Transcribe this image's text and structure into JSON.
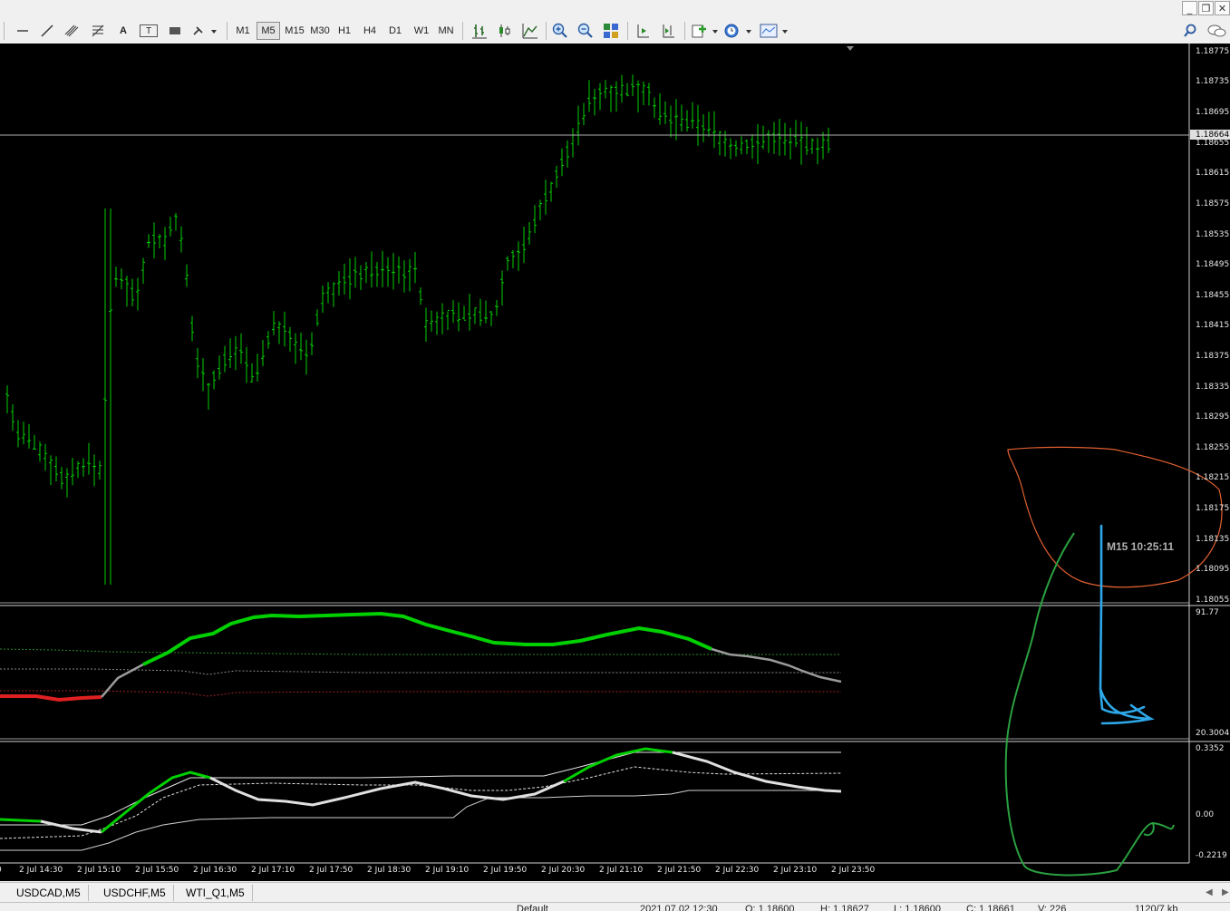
{
  "window_controls": {
    "minimize": "_",
    "restore": "❐",
    "close": "✕"
  },
  "toolbar": {
    "timeframes": [
      "M1",
      "M5",
      "M15",
      "M30",
      "H1",
      "H4",
      "D1",
      "W1",
      "MN"
    ],
    "active_timeframe": "M5",
    "text_tool_label": "A",
    "text_label_tool": "T"
  },
  "price_axis": {
    "labels": [
      "1.18775",
      "1.18735",
      "1.18695",
      "1.18655",
      "1.18615",
      "1.18575",
      "1.18535",
      "1.18495",
      "1.18455",
      "1.18415",
      "1.18375",
      "1.18335",
      "1.18295",
      "1.18255",
      "1.18215",
      "1.18175",
      "1.18135",
      "1.18095",
      "1.18055"
    ],
    "current_price": "1.18664"
  },
  "indicator1_axis": {
    "top": "91.77",
    "bottom": "20.3004"
  },
  "indicator2_axis": {
    "top": "0.3352",
    "mid": "0.00",
    "bottom": "-0.2219"
  },
  "time_axis": {
    "labels": [
      "2 Jul 14:30",
      "2 Jul 15:10",
      "2 Jul 15:50",
      "2 Jul 16:30",
      "2 Jul 17:10",
      "2 Jul 17:50",
      "2 Jul 18:30",
      "2 Jul 19:10",
      "2 Jul 19:50",
      "2 Jul 20:30",
      "2 Jul 21:10",
      "2 Jul 21:50",
      "2 Jul 22:30",
      "2 Jul 23:10",
      "2 Jul 23:50"
    ]
  },
  "countdown": "M15 10:25:11",
  "tabs": [
    "USDCAD,M5",
    "USDCHF,M5",
    "WTI_Q1,M5"
  ],
  "status": {
    "profile": "Default",
    "datetime": "2021.07.02 12:30",
    "open": "O: 1.18600",
    "high": "H: 1.18627",
    "low": "L: 1.18600",
    "close": "C: 1.18661",
    "volume": "V: 226",
    "traffic": "1120/7 kb"
  },
  "colors": {
    "bull": "#00d000",
    "bear": "#e02020",
    "neutral": "#9a9a9a",
    "white_line": "#e0e0e0",
    "annotation_orange": "#e06030",
    "annotation_blue": "#2ea8e8",
    "annotation_green": "#2aa040"
  },
  "chart_data": {
    "type": "bar",
    "symbol_timeframe": "M5",
    "x": [
      "2 Jul 14:30",
      "2 Jul 15:10",
      "2 Jul 15:50",
      "2 Jul 16:30",
      "2 Jul 17:10",
      "2 Jul 17:50",
      "2 Jul 18:30",
      "2 Jul 19:10",
      "2 Jul 19:50",
      "2 Jul 20:30",
      "2 Jul 21:10",
      "2 Jul 21:50",
      "2 Jul 22:30",
      "2 Jul 23:10",
      "2 Jul 23:50"
    ],
    "close": [
      1.1825,
      1.1828,
      1.1847,
      1.184,
      1.1843,
      1.1844,
      1.1848,
      1.1843,
      1.1846,
      1.1863,
      1.1871,
      1.1868,
      1.1864,
      1.1866,
      1.1866
    ],
    "ylim": [
      1.18055,
      1.18775
    ],
    "indicator1": {
      "ylim": [
        20.3004,
        91.77
      ]
    },
    "indicator2": {
      "ylim": [
        -0.2219,
        0.3352
      ]
    }
  }
}
